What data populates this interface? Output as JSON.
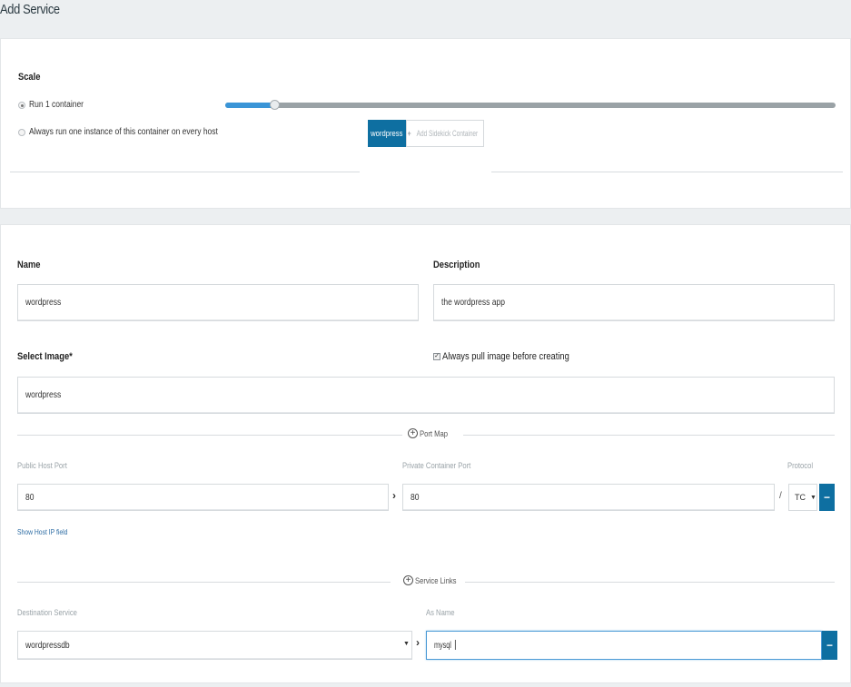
{
  "page": {
    "title": "Add Service"
  },
  "scale": {
    "label": "Scale",
    "options": [
      {
        "label": "Run 1 container",
        "checked": true
      },
      {
        "label": "Always run one instance of this container on every host",
        "checked": false
      }
    ],
    "slider": {
      "value": 1,
      "fill_fraction": 0.08
    }
  },
  "tabs": {
    "active": "wordpress",
    "add_sidekick": "Add Sidekick Container"
  },
  "form": {
    "name_label": "Name",
    "name_value": "wordpress",
    "description_label": "Description",
    "description_value": "the wordpress app",
    "image_label": "Select Image*",
    "image_value": "wordpress",
    "pull_label": "Always pull image before creating",
    "pull_checked": true
  },
  "port_map": {
    "title": "Port Map",
    "public_label": "Public Host Port",
    "private_label": "Private Container Port",
    "protocol_label": "Protocol",
    "public_value": "80",
    "private_value": "80",
    "protocol_value": "TC",
    "show_host_ip": "Show Host IP field",
    "arrow": "›",
    "slash": "/"
  },
  "service_links": {
    "title": "Service Links",
    "destination_label": "Destination Service",
    "as_name_label": "As Name",
    "destination_value": "wordpressdb",
    "as_name_value": "mysql",
    "arrow": "›"
  },
  "colors": {
    "accent": "#0e6fa1",
    "slider_fill": "#3a95d7"
  }
}
